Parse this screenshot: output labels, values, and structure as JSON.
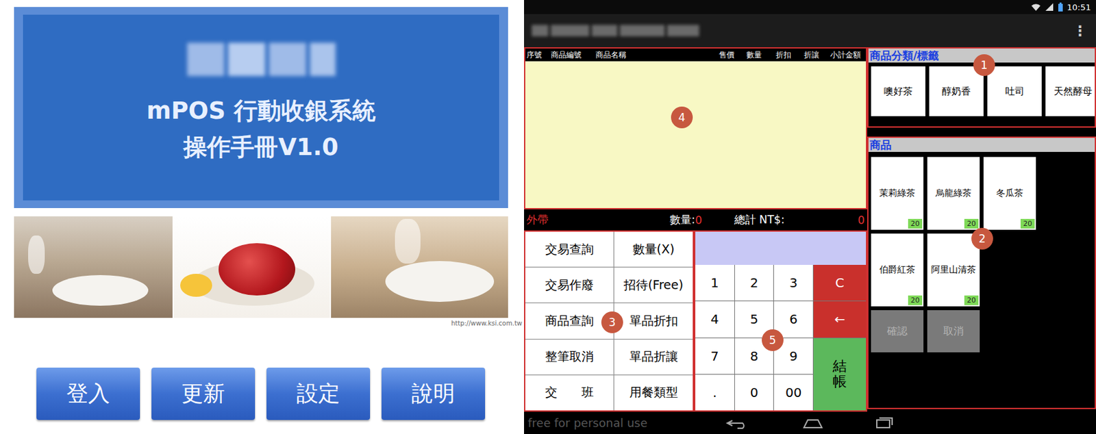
{
  "manual": {
    "title_lines": [
      "mPOS 行動收銀系統",
      "操作手冊V1.0"
    ],
    "photo_url": "http://www.ksi.com.tw",
    "buttons": [
      "登入",
      "更新",
      "設定",
      "說明"
    ]
  },
  "pos": {
    "status_bar": {
      "time": "10:51"
    },
    "menu_icon": "⋮",
    "table": {
      "columns": [
        "序號",
        "商品編號",
        "商品名稱",
        "售價",
        "數量",
        "折扣",
        "折讓",
        "小計金額"
      ]
    },
    "summary": {
      "mode": "外帶",
      "qty_label": "數量:",
      "qty": "0",
      "total_label": "總計 NT$:",
      "total": "0"
    },
    "functions": [
      "交易查詢",
      "數量(X)",
      "交易作廢",
      "招待(Free)",
      "商品查詢",
      "單品折扣",
      "整筆取消",
      "單品折讓",
      "交　　班",
      "用餐類型"
    ],
    "keypad": [
      {
        "label": "1",
        "kind": "digit"
      },
      {
        "label": "2",
        "kind": "digit"
      },
      {
        "label": "3",
        "kind": "digit"
      },
      {
        "label": "C",
        "kind": "clear"
      },
      {
        "label": "4",
        "kind": "digit"
      },
      {
        "label": "5",
        "kind": "digit"
      },
      {
        "label": "6",
        "kind": "digit"
      },
      {
        "label": "←",
        "kind": "back"
      },
      {
        "label": "7",
        "kind": "digit"
      },
      {
        "label": "8",
        "kind": "digit"
      },
      {
        "label": "9",
        "kind": "digit"
      },
      {
        "label": "結帳",
        "kind": "checkout"
      },
      {
        "label": ".",
        "kind": "digit"
      },
      {
        "label": "0",
        "kind": "digit"
      },
      {
        "label": "00",
        "kind": "digit"
      }
    ],
    "categories": {
      "title": "商品分類/標籤",
      "items": [
        "噢好茶",
        "醇奶香",
        "吐司",
        "天然酵母"
      ]
    },
    "products": {
      "title": "商品",
      "items": [
        {
          "name": "茉莉綠茶",
          "price": "20"
        },
        {
          "name": "烏龍綠茶",
          "price": "20"
        },
        {
          "name": "冬瓜茶",
          "price": "20"
        },
        {
          "name": "伯爵紅茶",
          "price": "20"
        },
        {
          "name": "阿里山清茶",
          "price": "20"
        }
      ]
    },
    "actions": [
      {
        "label": "確認",
        "disabled": true
      },
      {
        "label": "取消",
        "disabled": true
      }
    ],
    "callouts": [
      "1",
      "2",
      "3",
      "4",
      "5"
    ],
    "watermark": "free for personal use"
  }
}
